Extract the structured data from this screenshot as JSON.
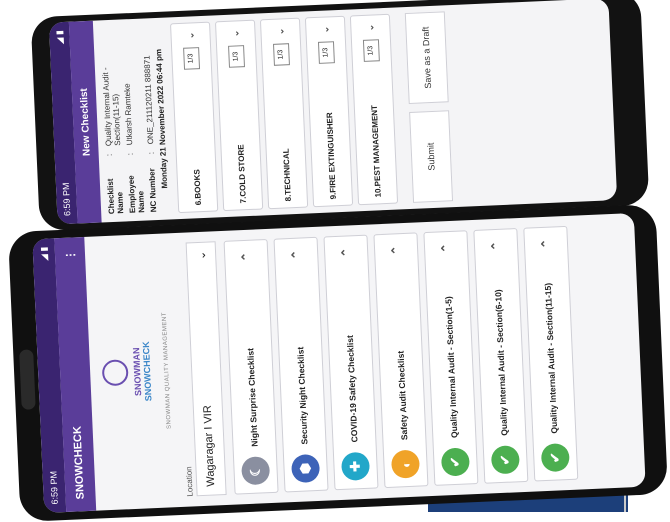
{
  "back_phone": {
    "status_time": "6:59 PM",
    "status_right": "◢ ▮",
    "title": "New Checklist",
    "info": [
      {
        "label": "Checklist Name",
        "sep": ":",
        "value": "Quality Internal Audit - Section(11-15)"
      },
      {
        "label": "Employee Name",
        "sep": ":",
        "value": "Utkarsh Ramteke"
      },
      {
        "label": "NC Number",
        "sep": ":",
        "value": "ONE_211120211 888871"
      }
    ],
    "date": "Monday 21 November 2022 06:44 pm",
    "items": [
      {
        "label": "6.BOOKS",
        "count": "1/3"
      },
      {
        "label": "7.COLD STORE",
        "count": "1/3"
      },
      {
        "label": "8.TECHNICAL",
        "count": "1/3"
      },
      {
        "label": "9.FIRE EXTINGUISHER",
        "count": "1/3"
      },
      {
        "label": "10.PEST MANAGEMENT",
        "count": "1/3"
      }
    ],
    "chevron": "⌄",
    "submit_label": "Submit",
    "draft_label": "Save as a Draft"
  },
  "front_phone": {
    "status_time": "6:59 PM",
    "status_right": "◢ ▮",
    "app_title": "SNOWCHECK",
    "menu_icon": "⋮",
    "logo_line1": "SNOWMAN",
    "logo_line2": "SNOWCHECK",
    "tagline": "SNOWMAN QUALITY MANAGEMENT",
    "location_label": "Location",
    "location_value": "Wagaragar I VIR",
    "location_chevron": "⌄",
    "chevron": "⌃",
    "items": [
      {
        "label": "Night Surprise Checklist",
        "icon": "moon-icon",
        "color": "#8a8fa0",
        "glyph": "☾"
      },
      {
        "label": "Security Night Checklist",
        "icon": "security-badge-icon",
        "color": "#3d63b8",
        "glyph": "⬢"
      },
      {
        "label": "COVID-19 Safety Checklist",
        "icon": "covid-shield-icon",
        "color": "#22a7c9",
        "glyph": "✚"
      },
      {
        "label": "Safety Audit Checklist",
        "icon": "safety-audit-icon",
        "color": "#f0a328",
        "glyph": "◐"
      },
      {
        "label": "Quality Internal Audit - Section(1-5)",
        "icon": "checklist-icon",
        "color": "#4caf50",
        "glyph": "✔"
      },
      {
        "label": "Quality Internal Audit - Section(6-10)",
        "icon": "checklist-icon",
        "color": "#4caf50",
        "glyph": "✔"
      },
      {
        "label": "Quality Internal Audit - Section(11-15)",
        "icon": "checklist-icon",
        "color": "#4caf50",
        "glyph": "✔"
      }
    ]
  }
}
